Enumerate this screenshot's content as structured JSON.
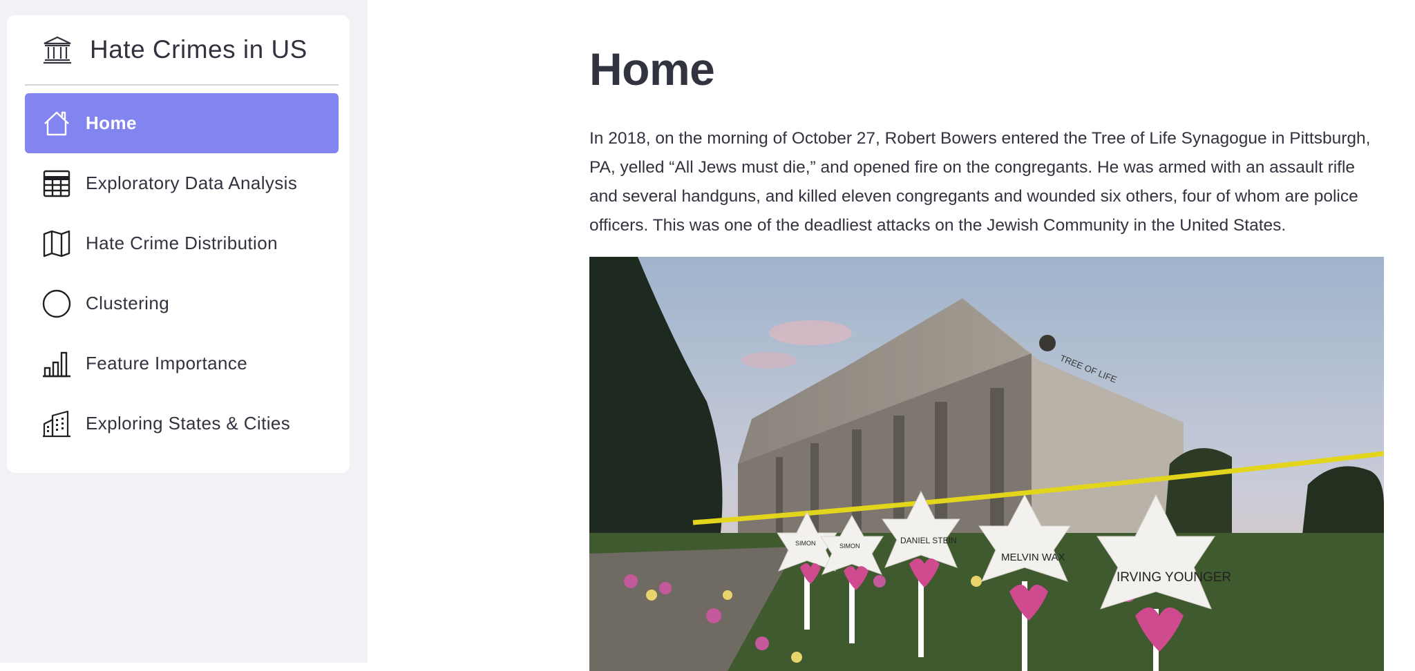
{
  "sidebar": {
    "title": "Hate Crimes in US",
    "title_icon": "bank-icon",
    "items": [
      {
        "label": "Home",
        "icon": "house-icon",
        "active": true
      },
      {
        "label": "Exploratory Data Analysis",
        "icon": "table-icon",
        "active": false
      },
      {
        "label": "Hate Crime Distribution",
        "icon": "map-icon",
        "active": false
      },
      {
        "label": "Clustering",
        "icon": "circle-icon",
        "active": false
      },
      {
        "label": "Feature Importance",
        "icon": "bar-chart-icon",
        "active": false
      },
      {
        "label": "Exploring States & Cities",
        "icon": "buildings-icon",
        "active": false
      }
    ]
  },
  "main": {
    "title": "Home",
    "intro": "In 2018, on the morning of October 27, Robert Bowers entered the Tree of Life Synagogue in Pittsburgh, PA, yelled “All Jews must die,” and opened fire on the congregants. He was armed with an assault rifle and several handguns, and killed eleven congregants and wounded six others, four of whom are police officers. This was one of the deadliest attacks on the Jewish Community in the United States.",
    "photo": {
      "building_sign": "TREE OF LIFE",
      "star_names": [
        "SIMON",
        "SIMON",
        "DANIEL STEIN",
        "MELVIN WAX",
        "IRVING YOUNGER"
      ]
    }
  },
  "colors": {
    "accent": "#8285ef",
    "sidebar_bg": "#f0f2f6",
    "text": "#31333f"
  }
}
